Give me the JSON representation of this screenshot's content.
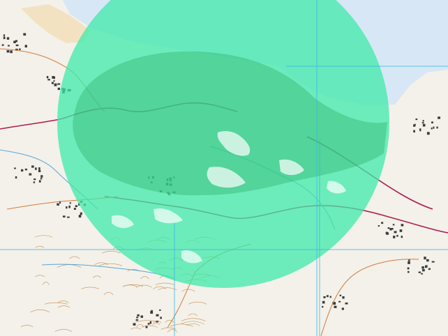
{
  "map": {
    "colors": {
      "land": "#f3f1ea",
      "sea": "#d8e7f5",
      "sand": "#f3e2c2",
      "coverage": "#3fe9a9",
      "coverage_opacity": 0.75,
      "coverage_dense": "#23a85f",
      "road_main": "#b01a52",
      "road_minor": "#d77a3a",
      "water": "#5aa6d6",
      "grid": "#39b7e6",
      "contour": "#c98e4a",
      "settlement": "#3b3b3b"
    },
    "layers": {
      "base_map": "topographic",
      "overlay": "coverage-circle",
      "grid_lines": true
    }
  }
}
